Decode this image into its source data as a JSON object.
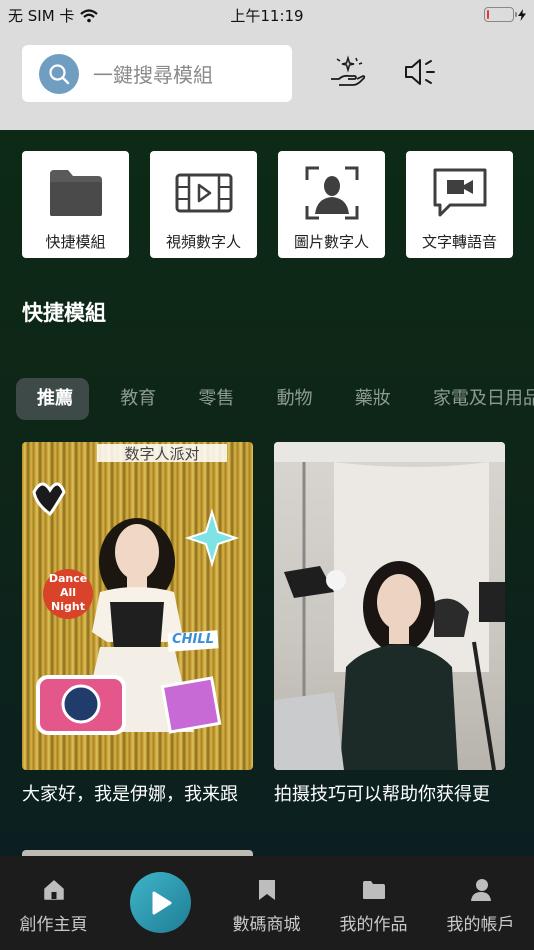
{
  "status_bar": {
    "carrier": "无 SIM 卡",
    "time": "上午11:19",
    "battery_level_fraction": 0.1,
    "battery_color": "#e53935"
  },
  "header": {
    "search_placeholder": "一鍵搜尋模組",
    "icons": [
      "search-icon",
      "hand-sparkle-icon",
      "speaker-icon"
    ]
  },
  "quick_actions": [
    {
      "label": "快捷模組",
      "icon": "folder-icon"
    },
    {
      "label": "視頻數字人",
      "icon": "film-play-icon"
    },
    {
      "label": "圖片數字人",
      "icon": "portrait-frame-icon"
    },
    {
      "label": "文字轉語音",
      "icon": "chat-video-icon"
    }
  ],
  "section_title": "快捷模組",
  "tabs": [
    {
      "label": "推薦",
      "active": true
    },
    {
      "label": "教育",
      "active": false
    },
    {
      "label": "零售",
      "active": false
    },
    {
      "label": "動物",
      "active": false
    },
    {
      "label": "藥妝",
      "active": false
    },
    {
      "label": "家電及日用品",
      "active": false
    }
  ],
  "videos": [
    {
      "caption": "大家好，我是伊娜，我来跟",
      "banner_text": "数字人派对",
      "stickers": [
        "Dance All Night",
        "CHILL"
      ]
    },
    {
      "caption": "拍摄技巧可以帮助你获得更"
    }
  ],
  "bottom_nav": [
    {
      "label": "創作主頁",
      "icon": "home-icon"
    },
    {
      "label": "",
      "icon": "play-icon"
    },
    {
      "label": "數碼商城",
      "icon": "bookmark-icon"
    },
    {
      "label": "我的作品",
      "icon": "folder-icon"
    },
    {
      "label": "我的帳戶",
      "icon": "user-icon"
    }
  ],
  "colors": {
    "accent": "#6f9ec0",
    "play_button": "#2a9bb3",
    "background": "#0d2418",
    "nav_background": "#1c1c1c"
  }
}
